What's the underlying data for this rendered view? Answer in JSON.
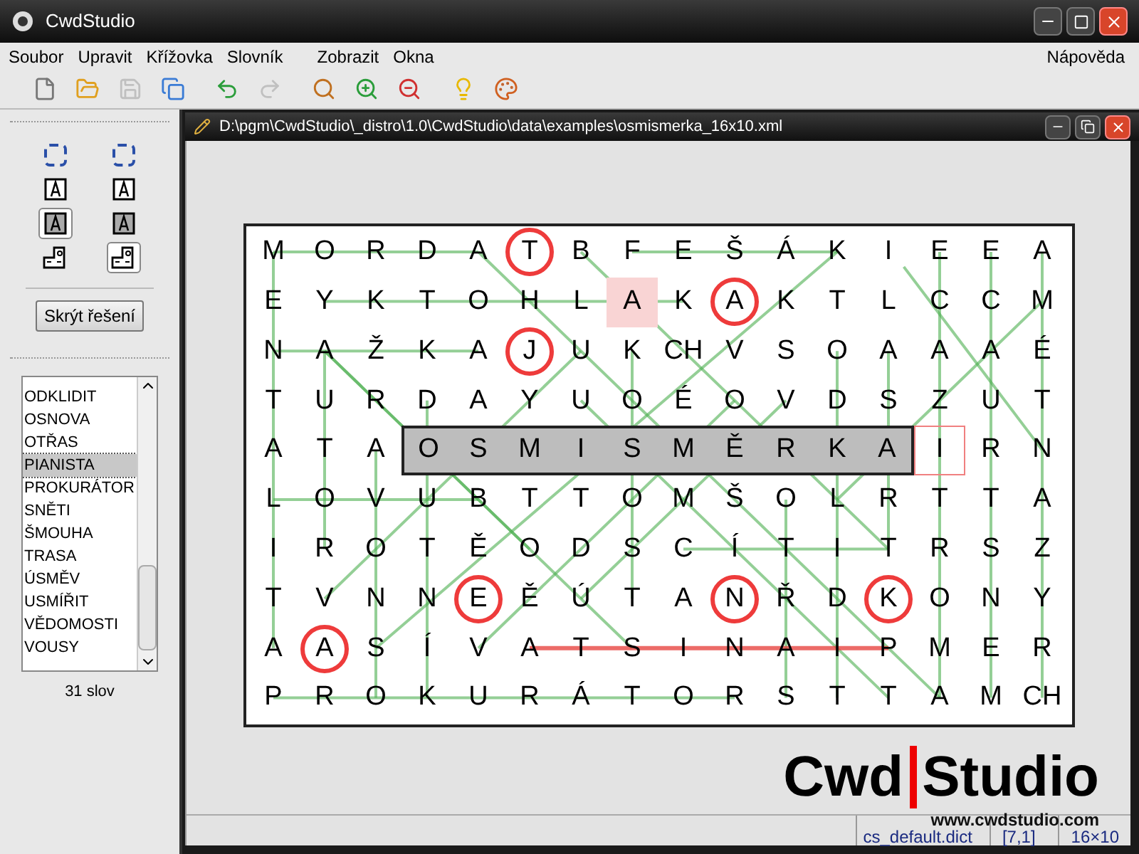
{
  "window": {
    "title": "CwdStudio"
  },
  "menu": [
    {
      "label": "Soubor"
    },
    {
      "label": "Upravit"
    },
    {
      "label": "Křížovka"
    },
    {
      "label": "Slovník"
    },
    {
      "label": "Zobrazit"
    },
    {
      "label": "Okna"
    }
  ],
  "help_menu": {
    "label": "Nápověda"
  },
  "toolbar": [
    {
      "kind": "new",
      "disabled": false
    },
    {
      "kind": "open",
      "disabled": false
    },
    {
      "kind": "save",
      "disabled": true
    },
    {
      "kind": "saveall",
      "disabled": false
    },
    {
      "kind": "undo",
      "disabled": false
    },
    {
      "kind": "redo",
      "disabled": true
    },
    {
      "kind": "zoom",
      "disabled": false
    },
    {
      "kind": "zoomin",
      "disabled": false
    },
    {
      "kind": "zoomout",
      "disabled": false
    },
    {
      "kind": "bulb",
      "disabled": false
    },
    {
      "kind": "palette",
      "disabled": false
    }
  ],
  "tools": [
    {
      "kind": "select",
      "selected": false
    },
    {
      "kind": "select",
      "selected": false
    },
    {
      "kind": "letter",
      "selected": false
    },
    {
      "kind": "letter",
      "selected": false
    },
    {
      "kind": "letterfill",
      "selected": true
    },
    {
      "kind": "letterfill",
      "selected": false
    },
    {
      "kind": "shape",
      "selected": false
    },
    {
      "kind": "shape",
      "selected": true
    }
  ],
  "toggle_button": {
    "label": "Skrýt řešení"
  },
  "word_list": {
    "items": [
      {
        "label": "ODKLIDIT",
        "selected": false
      },
      {
        "label": "OSNOVA",
        "selected": false
      },
      {
        "label": "OTŘAS",
        "selected": false
      },
      {
        "label": "PIANISTA",
        "selected": true
      },
      {
        "label": "PROKURÁTOR",
        "selected": false
      },
      {
        "label": "SNĚTI",
        "selected": false
      },
      {
        "label": "ŠMOUHA",
        "selected": false
      },
      {
        "label": "TRASA",
        "selected": false
      },
      {
        "label": "ÚSMĚV",
        "selected": false
      },
      {
        "label": "USMÍŘIT",
        "selected": false
      },
      {
        "label": "VĚDOMOSTI",
        "selected": false
      },
      {
        "label": "VOUSY",
        "selected": false
      }
    ],
    "count": "31 slov"
  },
  "document": {
    "title": "D:\\pgm\\CwdStudio\\_distro\\1.0\\CwdStudio\\data\\examples\\osmismerka_16x10.xml",
    "rows": [
      {
        "cells": [
          {
            "letter": "M",
            "kind": "plain"
          },
          {
            "letter": "O",
            "kind": "plain"
          },
          {
            "letter": "R",
            "kind": "plain"
          },
          {
            "letter": "D",
            "kind": "plain"
          },
          {
            "letter": "A",
            "kind": "plain"
          },
          {
            "letter": "T",
            "kind": "circled"
          },
          {
            "letter": "B",
            "kind": "plain"
          },
          {
            "letter": "F",
            "kind": "plain"
          },
          {
            "letter": "E",
            "kind": "plain"
          },
          {
            "letter": "Š",
            "kind": "plain"
          },
          {
            "letter": "Á",
            "kind": "plain"
          },
          {
            "letter": "K",
            "kind": "plain"
          },
          {
            "letter": "I",
            "kind": "plain"
          },
          {
            "letter": "E",
            "kind": "plain"
          },
          {
            "letter": "E",
            "kind": "plain"
          },
          {
            "letter": "A",
            "kind": "plain"
          }
        ]
      },
      {
        "cells": [
          {
            "letter": "E",
            "kind": "plain"
          },
          {
            "letter": "Y",
            "kind": "plain"
          },
          {
            "letter": "K",
            "kind": "plain"
          },
          {
            "letter": "T",
            "kind": "plain"
          },
          {
            "letter": "O",
            "kind": "plain"
          },
          {
            "letter": "H",
            "kind": "plain"
          },
          {
            "letter": "L",
            "kind": "plain"
          },
          {
            "letter": "A",
            "kind": "hint"
          },
          {
            "letter": "K",
            "kind": "plain"
          },
          {
            "letter": "A",
            "kind": "circled"
          },
          {
            "letter": "K",
            "kind": "plain"
          },
          {
            "letter": "T",
            "kind": "plain"
          },
          {
            "letter": "L",
            "kind": "plain"
          },
          {
            "letter": "C",
            "kind": "plain"
          },
          {
            "letter": "C",
            "kind": "plain"
          },
          {
            "letter": "M",
            "kind": "plain"
          }
        ]
      },
      {
        "cells": [
          {
            "letter": "N",
            "kind": "plain"
          },
          {
            "letter": "A",
            "kind": "plain"
          },
          {
            "letter": "Ž",
            "kind": "plain"
          },
          {
            "letter": "K",
            "kind": "plain"
          },
          {
            "letter": "A",
            "kind": "plain"
          },
          {
            "letter": "J",
            "kind": "circled"
          },
          {
            "letter": "U",
            "kind": "plain"
          },
          {
            "letter": "K",
            "kind": "plain"
          },
          {
            "letter": "CH",
            "kind": "plain"
          },
          {
            "letter": "V",
            "kind": "plain"
          },
          {
            "letter": "S",
            "kind": "plain"
          },
          {
            "letter": "O",
            "kind": "plain"
          },
          {
            "letter": "A",
            "kind": "plain"
          },
          {
            "letter": "A",
            "kind": "plain"
          },
          {
            "letter": "A",
            "kind": "plain"
          },
          {
            "letter": "É",
            "kind": "plain"
          }
        ]
      },
      {
        "cells": [
          {
            "letter": "T",
            "kind": "plain"
          },
          {
            "letter": "U",
            "kind": "plain"
          },
          {
            "letter": "R",
            "kind": "plain"
          },
          {
            "letter": "D",
            "kind": "plain"
          },
          {
            "letter": "A",
            "kind": "plain"
          },
          {
            "letter": "Y",
            "kind": "plain"
          },
          {
            "letter": "U",
            "kind": "plain"
          },
          {
            "letter": "O",
            "kind": "plain"
          },
          {
            "letter": "É",
            "kind": "plain"
          },
          {
            "letter": "O",
            "kind": "plain"
          },
          {
            "letter": "V",
            "kind": "plain"
          },
          {
            "letter": "D",
            "kind": "plain"
          },
          {
            "letter": "S",
            "kind": "plain"
          },
          {
            "letter": "Z",
            "kind": "plain"
          },
          {
            "letter": "U",
            "kind": "plain"
          },
          {
            "letter": "T",
            "kind": "plain"
          }
        ]
      },
      {
        "cells": [
          {
            "letter": "A",
            "kind": "plain"
          },
          {
            "letter": "T",
            "kind": "plain"
          },
          {
            "letter": "A",
            "kind": "plain"
          },
          {
            "letter": "O",
            "kind": "selected"
          },
          {
            "letter": "S",
            "kind": "selected"
          },
          {
            "letter": "M",
            "kind": "selected"
          },
          {
            "letter": "I",
            "kind": "selected"
          },
          {
            "letter": "S",
            "kind": "selected"
          },
          {
            "letter": "M",
            "kind": "selected"
          },
          {
            "letter": "Ě",
            "kind": "selected"
          },
          {
            "letter": "R",
            "kind": "selected"
          },
          {
            "letter": "K",
            "kind": "selected"
          },
          {
            "letter": "A",
            "kind": "selected"
          },
          {
            "letter": "I",
            "kind": "cursor"
          },
          {
            "letter": "R",
            "kind": "plain"
          },
          {
            "letter": "N",
            "kind": "plain"
          }
        ]
      },
      {
        "cells": [
          {
            "letter": "L",
            "kind": "plain"
          },
          {
            "letter": "O",
            "kind": "plain"
          },
          {
            "letter": "V",
            "kind": "plain"
          },
          {
            "letter": "U",
            "kind": "plain"
          },
          {
            "letter": "B",
            "kind": "plain"
          },
          {
            "letter": "T",
            "kind": "plain"
          },
          {
            "letter": "T",
            "kind": "plain"
          },
          {
            "letter": "O",
            "kind": "plain"
          },
          {
            "letter": "M",
            "kind": "plain"
          },
          {
            "letter": "Š",
            "kind": "plain"
          },
          {
            "letter": "O",
            "kind": "plain"
          },
          {
            "letter": "L",
            "kind": "plain"
          },
          {
            "letter": "R",
            "kind": "plain"
          },
          {
            "letter": "T",
            "kind": "plain"
          },
          {
            "letter": "T",
            "kind": "plain"
          },
          {
            "letter": "A",
            "kind": "plain"
          }
        ]
      },
      {
        "cells": [
          {
            "letter": "I",
            "kind": "plain"
          },
          {
            "letter": "R",
            "kind": "plain"
          },
          {
            "letter": "O",
            "kind": "plain"
          },
          {
            "letter": "T",
            "kind": "plain"
          },
          {
            "letter": "Ě",
            "kind": "plain"
          },
          {
            "letter": "O",
            "kind": "plain"
          },
          {
            "letter": "D",
            "kind": "plain"
          },
          {
            "letter": "S",
            "kind": "plain"
          },
          {
            "letter": "C",
            "kind": "plain"
          },
          {
            "letter": "Í",
            "kind": "plain"
          },
          {
            "letter": "T",
            "kind": "plain"
          },
          {
            "letter": "I",
            "kind": "plain"
          },
          {
            "letter": "T",
            "kind": "plain"
          },
          {
            "letter": "R",
            "kind": "plain"
          },
          {
            "letter": "S",
            "kind": "plain"
          },
          {
            "letter": "Z",
            "kind": "plain"
          }
        ]
      },
      {
        "cells": [
          {
            "letter": "T",
            "kind": "plain"
          },
          {
            "letter": "V",
            "kind": "plain"
          },
          {
            "letter": "N",
            "kind": "plain"
          },
          {
            "letter": "N",
            "kind": "plain"
          },
          {
            "letter": "E",
            "kind": "circled"
          },
          {
            "letter": "Ě",
            "kind": "plain"
          },
          {
            "letter": "Ú",
            "kind": "plain"
          },
          {
            "letter": "T",
            "kind": "plain"
          },
          {
            "letter": "A",
            "kind": "plain"
          },
          {
            "letter": "N",
            "kind": "circled"
          },
          {
            "letter": "Ř",
            "kind": "plain"
          },
          {
            "letter": "D",
            "kind": "plain"
          },
          {
            "letter": "K",
            "kind": "circled"
          },
          {
            "letter": "O",
            "kind": "plain"
          },
          {
            "letter": "N",
            "kind": "plain"
          },
          {
            "letter": "Y",
            "kind": "plain"
          }
        ]
      },
      {
        "cells": [
          {
            "letter": "A",
            "kind": "plain"
          },
          {
            "letter": "A",
            "kind": "circled"
          },
          {
            "letter": "S",
            "kind": "plain"
          },
          {
            "letter": "Í",
            "kind": "plain"
          },
          {
            "letter": "V",
            "kind": "plain"
          },
          {
            "letter": "A",
            "kind": "plain"
          },
          {
            "letter": "T",
            "kind": "plain"
          },
          {
            "letter": "S",
            "kind": "plain"
          },
          {
            "letter": "I",
            "kind": "plain"
          },
          {
            "letter": "N",
            "kind": "plain"
          },
          {
            "letter": "A",
            "kind": "plain"
          },
          {
            "letter": "I",
            "kind": "plain"
          },
          {
            "letter": "P",
            "kind": "plain"
          },
          {
            "letter": "M",
            "kind": "plain"
          },
          {
            "letter": "E",
            "kind": "plain"
          },
          {
            "letter": "R",
            "kind": "plain"
          }
        ]
      },
      {
        "cells": [
          {
            "letter": "P",
            "kind": "plain"
          },
          {
            "letter": "R",
            "kind": "plain"
          },
          {
            "letter": "O",
            "kind": "plain"
          },
          {
            "letter": "K",
            "kind": "plain"
          },
          {
            "letter": "U",
            "kind": "plain"
          },
          {
            "letter": "R",
            "kind": "plain"
          },
          {
            "letter": "Á",
            "kind": "plain"
          },
          {
            "letter": "T",
            "kind": "plain"
          },
          {
            "letter": "O",
            "kind": "plain"
          },
          {
            "letter": "R",
            "kind": "plain"
          },
          {
            "letter": "S",
            "kind": "plain"
          },
          {
            "letter": "T",
            "kind": "plain"
          },
          {
            "letter": "T",
            "kind": "plain"
          },
          {
            "letter": "A",
            "kind": "plain"
          },
          {
            "letter": "M",
            "kind": "plain"
          },
          {
            "letter": "CH",
            "kind": "plain"
          }
        ]
      }
    ]
  },
  "logo": {
    "word_1": "Cwd",
    "word_2": "Studio",
    "url": "www.cwdstudio.com"
  },
  "status_bar": {
    "dictionary": "cs_default.dict",
    "position": "[7,1]",
    "size": "16×10"
  }
}
